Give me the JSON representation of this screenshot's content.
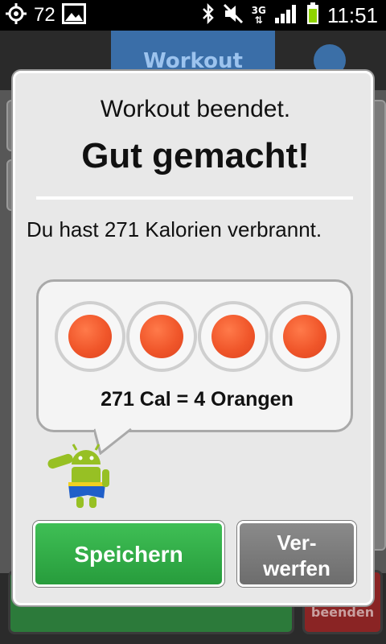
{
  "status_bar": {
    "notification_count": "72",
    "network_type": "3G",
    "time": "11:51"
  },
  "background_app": {
    "tab_title": "Workout",
    "finish_label": "beenden"
  },
  "dialog": {
    "title_line1": "Workout beendet.",
    "title_line2": "Gut gemacht!",
    "message": "Du hast 271 Kalorien verbrannt.",
    "equivalence": {
      "item_icon": "orange-icon",
      "item_count": 4,
      "caption": "271 Cal = 4 Orangen"
    },
    "buttons": {
      "save_label": "Speichern",
      "discard_label_line1": "Ver-",
      "discard_label_line2": "werfen"
    }
  },
  "colors": {
    "save_button": "#2ea845",
    "discard_button": "#7a7a7a",
    "orange": "#f0562a"
  }
}
